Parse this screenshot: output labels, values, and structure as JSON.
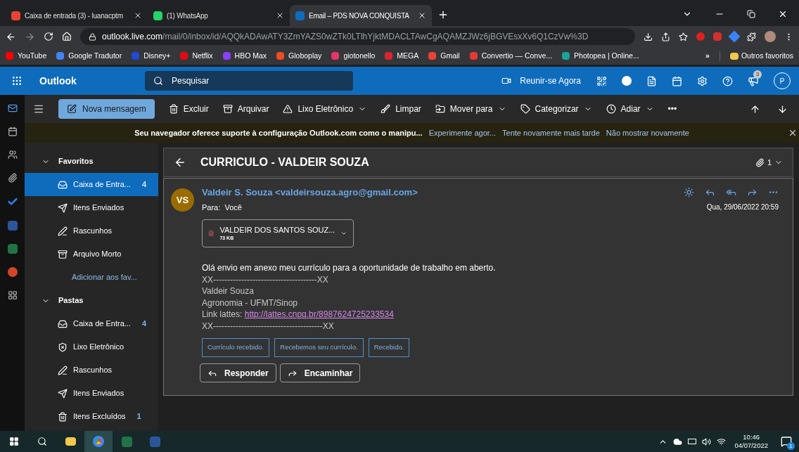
{
  "browser": {
    "tabs": [
      {
        "title": "Caixa de entrada (3) - luanacptm",
        "kind": "gmail",
        "selected": false
      },
      {
        "title": "(1) WhatsApp",
        "kind": "whatsapp",
        "selected": false
      },
      {
        "title": "Email – PDS NOVA CONQUISTA",
        "kind": "outlook",
        "selected": true
      }
    ],
    "url_host": "outlook.live.com",
    "url_path": "/mail/0/inbox/id/AQQkADAwATY3ZmYAZS0wZTk0LTlhYjktMDACLTAwCgAQAMZJWz6jBGVEsxXv6Q1CzVw%3D",
    "bookmarks": [
      {
        "label": "YouTube",
        "color": "#ff0000"
      },
      {
        "label": "Google Tradutor",
        "color": "#4285f4"
      },
      {
        "label": "Disney+",
        "color": "#1e4bd8"
      },
      {
        "label": "Netflix",
        "color": "#e50914"
      },
      {
        "label": "HBO Max",
        "color": "#8a3ffc"
      },
      {
        "label": "Globoplay",
        "color": "#f04b23"
      },
      {
        "label": "giotonello",
        "color": "#e8336d"
      },
      {
        "label": "MEGA",
        "color": "#d9272e"
      },
      {
        "label": "Gmail",
        "color": "#ea4335"
      },
      {
        "label": "Convertio — Conve...",
        "color": "#e53935"
      },
      {
        "label": "Photopea | Online...",
        "color": "#18a497"
      }
    ],
    "overflow": "»",
    "other_bookmarks": "Outros favoritos"
  },
  "header": {
    "app_name": "Outlook",
    "search_placeholder": "Pesquisar",
    "meet": "Reunir-se Agora",
    "notification_count": "3",
    "avatar": "P"
  },
  "toolbar": {
    "new_message": "Nova mensagem",
    "actions": [
      {
        "label": "Excluir",
        "kind": "delete",
        "dropdown": false
      },
      {
        "label": "Arquivar",
        "kind": "archive",
        "dropdown": false
      },
      {
        "label": "Lixo Eletrônico",
        "kind": "junk",
        "dropdown": true
      },
      {
        "label": "Limpar",
        "kind": "sweep",
        "dropdown": false
      },
      {
        "label": "Mover para",
        "kind": "move",
        "dropdown": true
      },
      {
        "label": "Categorizar",
        "kind": "tag",
        "dropdown": true
      },
      {
        "label": "Adiar",
        "kind": "snooze",
        "dropdown": true
      }
    ],
    "more": "•••"
  },
  "notice": {
    "message": "Seu navegador oferece suporte à configuração Outlook.com como o manipu...",
    "links": [
      "Experimente agor...",
      "Tente novamente mais tarde",
      "Não mostrar novamente"
    ]
  },
  "folders": [
    {
      "title": "Favoritos",
      "expanded": true,
      "add_link": "Adicionar aos fav...",
      "items": [
        {
          "label": "Caixa de Entra...",
          "kind": "inbox",
          "count": "4",
          "selected": true
        },
        {
          "label": "Itens Enviados",
          "kind": "sent",
          "selected": false
        },
        {
          "label": "Rascunhos",
          "kind": "drafts",
          "selected": false
        },
        {
          "label": "Arquivo Morto",
          "kind": "archive",
          "selected": false
        }
      ]
    },
    {
      "title": "Pastas",
      "expanded": true,
      "items": [
        {
          "label": "Caixa de Entra...",
          "kind": "inbox",
          "count": "4",
          "selected": false
        },
        {
          "label": "Lixo Eletrônico",
          "kind": "junk",
          "selected": false
        },
        {
          "label": "Rascunhos",
          "kind": "drafts",
          "selected": false
        },
        {
          "label": "Itens Enviados",
          "kind": "sent",
          "selected": false
        },
        {
          "label": "Itens Excluídos",
          "kind": "deleted",
          "count": "1",
          "selected": false
        }
      ]
    }
  ],
  "email": {
    "subject": "CURRICULO - VALDEIR SOUZA",
    "attachment_count": "1",
    "avatar": "VS",
    "sender": "Valdeir S. Souza <valdeirsouza.agro@gmail.com>",
    "to_label": "Para:",
    "to": "Você",
    "date": "Qua, 29/06/2022 20:59",
    "attachment": {
      "name": "VALDEIR DOS SANTOS SOUZ...",
      "size": "73 KB"
    },
    "body": [
      {
        "text": "Olá envio em anexo meu currículo para a oportunidade de trabalho em aberto.",
        "kind": "lead"
      },
      {
        "text": "XX-------------------------------------XX",
        "kind": "text"
      },
      {
        "text": "Valdeir Souza",
        "kind": "text"
      },
      {
        "text": "Agronomia - UFMT/Sinop",
        "kind": "text"
      },
      {
        "text": "Link lattes: ",
        "link": "http://lattes.cnpq.br/8987624725233534",
        "kind": "text"
      },
      {
        "text": "XX---------------------------------------XX",
        "kind": "text"
      }
    ],
    "quick_replies": [
      "Currículo recebido.",
      "Recebemos seu currículo.",
      "Recebido."
    ],
    "actions": [
      {
        "label": "Responder",
        "kind": "reply"
      },
      {
        "label": "Encaminhar",
        "kind": "forward"
      }
    ]
  },
  "taskbar": {
    "time": "10:46",
    "date": "04/07/2022",
    "notification_count": "1"
  }
}
